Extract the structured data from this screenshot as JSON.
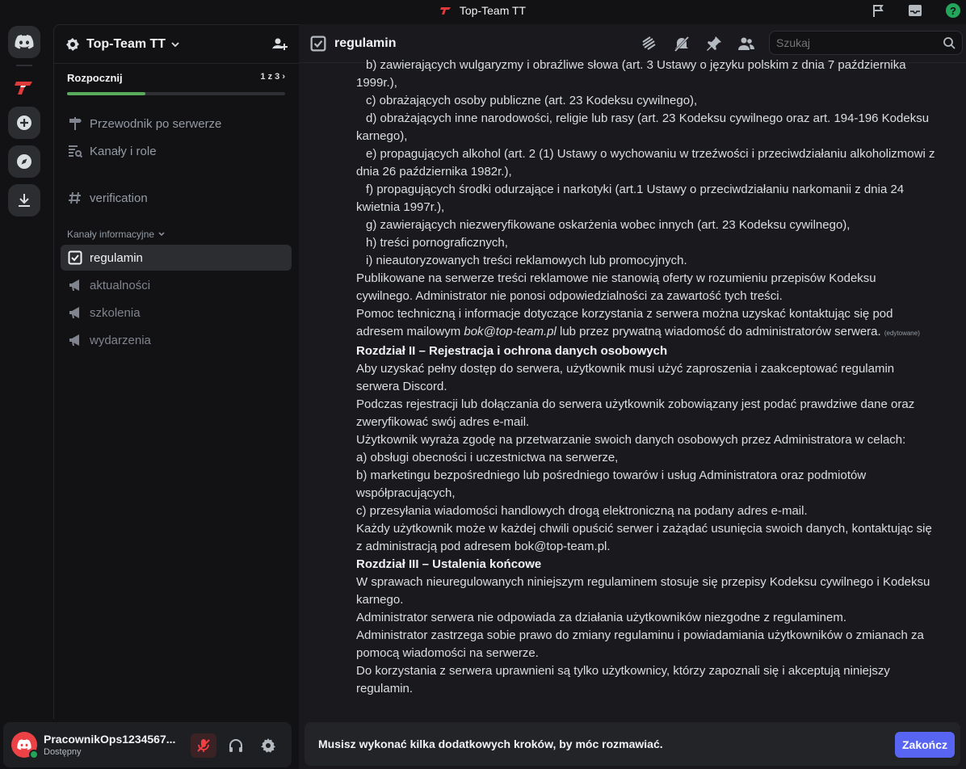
{
  "window": {
    "title": "Top-Team TT"
  },
  "colors": {
    "accent": "#5865f2",
    "online": "#23a55a",
    "progress": "#57ab5a",
    "danger": "#ed4245"
  },
  "server": {
    "name": "Top-Team TT",
    "onboarding": {
      "title": "Rozpocznij",
      "count": "1 z 3",
      "progress_fraction": 0.36
    },
    "nav": [
      {
        "label": "Przewodnik po serwerze",
        "icon": "signpost-icon"
      },
      {
        "label": "Kanały i role",
        "icon": "channels-roles-icon"
      }
    ],
    "verification_channel": "verification",
    "category": "Kanały informacyjne",
    "channels": [
      {
        "label": "regulamin",
        "icon": "rules-icon",
        "active": true
      },
      {
        "label": "aktualności",
        "icon": "announcement-icon",
        "active": false
      },
      {
        "label": "szkolenia",
        "icon": "announcement-icon",
        "active": false
      },
      {
        "label": "wydarzenia",
        "icon": "announcement-icon",
        "active": false
      }
    ]
  },
  "user": {
    "name": "PracownikOps1234567...",
    "status": "Dostępny"
  },
  "channel": {
    "title": "regulamin",
    "search_placeholder": "Szukaj"
  },
  "content": {
    "l1": "b) zawierających wulgaryzmy i obraźliwe słowa (art. 3 Ustawy o języku polskim z dnia 7 października",
    "l1b": "1999r.),",
    "l2": "c) obrażających osoby publiczne (art. 23 Kodeksu cywilnego),",
    "l3": "d) obrażających inne narodowości, religie lub rasy (art. 23 Kodeksu cywilnego oraz art. 194-196 Kodeksu",
    "l3b": "karnego),",
    "l4": "e) propagujących alkohol (art. 2 (1) Ustawy o wychowaniu w trzeźwości i przeciwdziałaniu alkoholizmowi z",
    "l4b": "dnia 26 października 1982r.),",
    "l5": "f) propagujących środki odurzające i narkotyki (art.1 Ustawy o przeciwdziałaniu narkomanii z dnia 24",
    "l5b": "kwietnia 1997r.),",
    "l6": "g) zawierających niezweryfikowane oskarżenia wobec innych (art. 23 Kodeksu cywilnego),",
    "l7": "h) treści pornograficznych,",
    "l8": "i) nieautoryzowanych treści reklamowych lub promocyjnych.",
    "p1": "Publikowane na serwerze treści reklamowe nie stanowią oferty w rozumieniu przepisów Kodeksu",
    "p1b": "cywilnego. Administrator nie ponosi odpowiedzialności za zawartość tych treści.",
    "p2": "Pomoc techniczną i informacje dotyczące korzystania z serwera można uzyskać kontaktując się pod",
    "p2b_pre": "adresem mailowym ",
    "p2b_email": "bok@top-team.pl",
    "p2b_post": " lub przez prywatną wiadomość do administratorów serwera.",
    "edited": "(edytowane)",
    "h2": "Rozdział II – Rejestracja i ochrona danych osobowych",
    "r1": "Aby uzyskać pełny dostęp do serwera, użytkownik musi użyć zaproszenia i zaakceptować regulamin",
    "r1b": "serwera Discord.",
    "r2": "Podczas rejestracji lub dołączania do serwera użytkownik zobowiązany jest podać prawdziwe dane oraz",
    "r2b": "zweryfikować swój adres e-mail.",
    "r3": "Użytkownik wyraża zgodę na przetwarzanie swoich danych osobowych przez Administratora w celach:",
    "r4": "a) obsługi obecności i uczestnictwa na serwerze,",
    "r5": "b) marketingu bezpośredniego lub pośredniego towarów i usług Administratora oraz podmiotów",
    "r5b": "współpracujących,",
    "r6": "c) przesyłania wiadomości handlowych drogą elektroniczną na podany adres e-mail.",
    "r7": "Każdy użytkownik może w każdej chwili opuścić serwer i zażądać usunięcia swoich danych, kontaktując się",
    "r7b": "z administracją pod adresem bok@top-team.pl.",
    "h3": "Rozdział III – Ustalenia końcowe",
    "u1": "W sprawach nieuregulowanych niniejszym regulaminem stosuje się przepisy Kodeksu cywilnego i Kodeksu",
    "u1b": "karnego.",
    "u2": "Administrator serwera nie odpowiada za działania użytkowników niezgodne z regulaminem.",
    "u3": "Administrator zastrzega sobie prawo do zmiany regulaminu i powiadamiania użytkowników o zmianach za",
    "u3b": "pomocą wiadomości na serwerze.",
    "u4": "Do korzystania z serwera uprawnieni są tylko użytkownicy, którzy zapoznali się i akceptują niniejszy",
    "u4b": "regulamin."
  },
  "composer": {
    "notice": "Musisz wykonać kilka dodatkowych kroków, by móc rozmawiać.",
    "button": "Zakończ"
  }
}
